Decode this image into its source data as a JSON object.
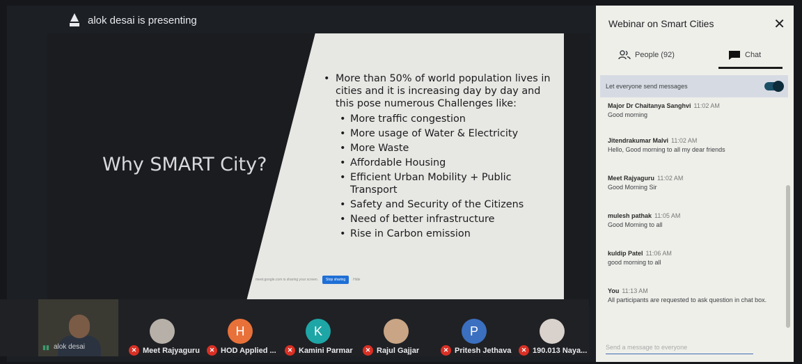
{
  "presenter": {
    "text": "alok desai is presenting"
  },
  "slide": {
    "title": "Why SMART City?",
    "bullets": [
      "More than 50% of world population lives in cities and it is increasing day by day and this pose numerous Challenges like:",
      "More traffic congestion",
      "More usage of Water & Electricity",
      "More Waste",
      "Affordable Housing",
      "Efficient Urban Mobility + Public Transport",
      "Safety and Security of the Citizens",
      "Need of better infrastructure",
      "Rise in Carbon emission"
    ],
    "share_notice": "meet.google.com is sharing your screen.",
    "stop_sharing": "Stop sharing",
    "hide": "Hide"
  },
  "participants": {
    "self_name": "alok desai",
    "tiles": [
      {
        "name": "Meet Rajyaguru",
        "initial": "",
        "color": "#b6b0a8"
      },
      {
        "name": "HOD Applied ...",
        "initial": "H",
        "color": "#e8713a"
      },
      {
        "name": "Kamini Parmar",
        "initial": "K",
        "color": "#1ea6a6"
      },
      {
        "name": "Rajul Gajjar",
        "initial": "",
        "color": "#c9a585"
      },
      {
        "name": "Pritesh Jethava",
        "initial": "P",
        "color": "#3b6fc0"
      },
      {
        "name": "190.013 Naya...",
        "initial": "",
        "color": "#d9d2cc"
      }
    ]
  },
  "panel": {
    "title": "Webinar on Smart Cities",
    "people_tab": "People (92)",
    "chat_tab": "Chat",
    "toggle_label": "Let everyone send messages",
    "messages": [
      {
        "name": "Major Dr Chaitanya Sanghvi",
        "time": "11:02 AM",
        "text": "Good morning"
      },
      {
        "name": "Jitendrakumar Malvi",
        "time": "11:02 AM",
        "text": "Hello, Good morning to all my dear friends"
      },
      {
        "name": "Meet Rajyaguru",
        "time": "11:02 AM",
        "text": "Good Morning Sir"
      },
      {
        "name": "mulesh pathak",
        "time": "11:05 AM",
        "text": "Good Morning to all"
      },
      {
        "name": "kuldip Patel",
        "time": "11:06 AM",
        "text": "good morning to all"
      },
      {
        "name": "You",
        "time": "11:13 AM",
        "text": "All participants are requested to ask question in chat box."
      }
    ],
    "input_placeholder": "Send a message to everyone"
  }
}
